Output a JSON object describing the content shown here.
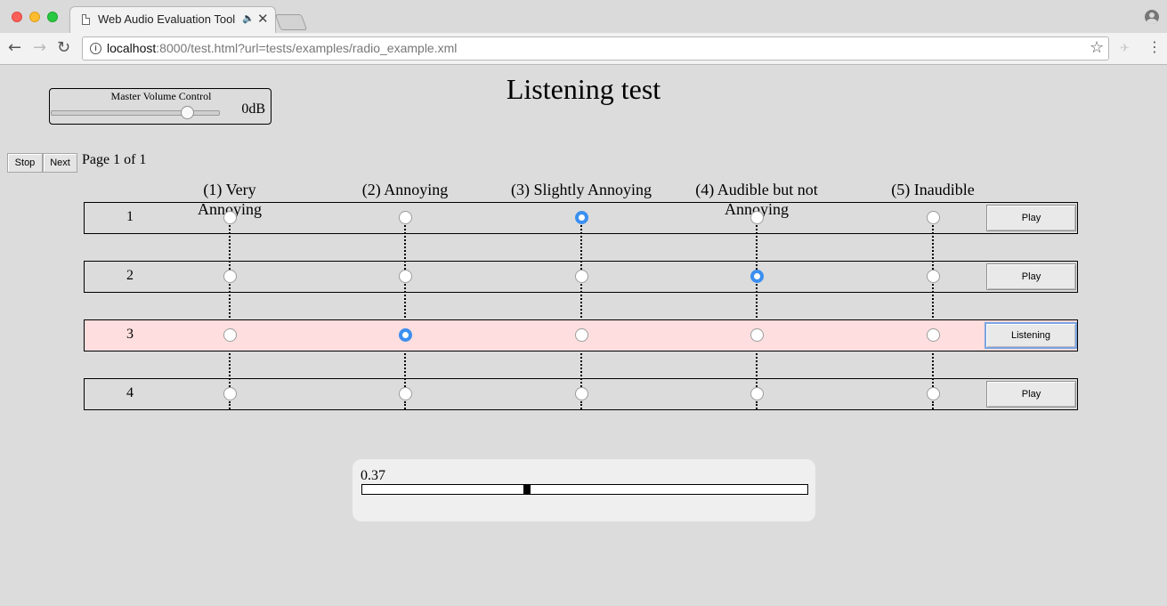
{
  "browser": {
    "tab_title": "Web Audio Evaluation Tool",
    "tab_audio_icon": "speaker-icon",
    "tab_close": "✕",
    "url_host": "localhost",
    "url_rest": ":8000/test.html?url=tests/examples/radio_example.xml",
    "info_glyph": "i"
  },
  "master_volume": {
    "label": "Master Volume Control",
    "value_text": "0dB",
    "level_fraction": 0.82
  },
  "page": {
    "title": "Listening test",
    "stop_label": "Stop",
    "next_label": "Next",
    "page_indicator": "Page 1 of 1"
  },
  "scale": {
    "labels": [
      "(1) Very\nAnnoying",
      "(2) Annoying",
      "(3) Slightly Annoying",
      "(4) Audible but not\nAnnoying",
      "(5) Inaudible"
    ]
  },
  "rows": [
    {
      "number": "1",
      "selected": 3,
      "button": "Play",
      "active": false
    },
    {
      "number": "2",
      "selected": 4,
      "button": "Play",
      "active": false
    },
    {
      "number": "3",
      "selected": 2,
      "button": "Listening",
      "active": true
    },
    {
      "number": "4",
      "selected": 0,
      "button": "Play",
      "active": false
    }
  ],
  "playback": {
    "value_text": "0.37",
    "position_fraction": 0.37
  },
  "colors": {
    "radio_checked": "#3b8ff0",
    "active_row": "#fedede",
    "page_background": "#dcdcdc"
  }
}
